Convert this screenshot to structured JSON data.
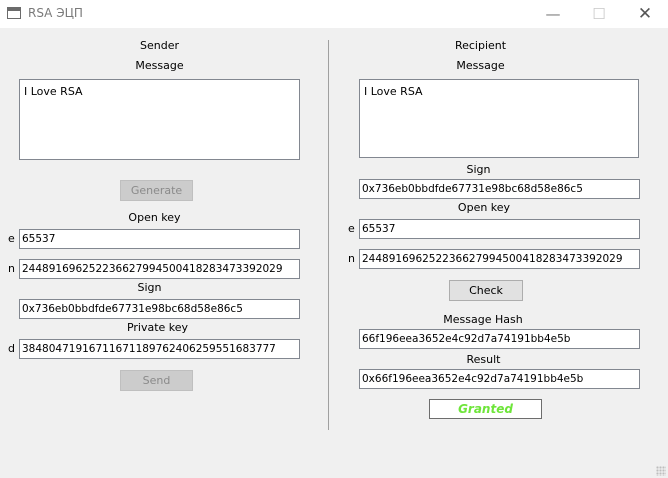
{
  "window": {
    "title": "RSA ЭЦП",
    "minimize_glyph": "—",
    "maximize_glyph": "☐",
    "close_glyph": "✕"
  },
  "sender": {
    "heading": "Sender",
    "message_label": "Message",
    "message_value": "I Love RSA",
    "generate_label": "Generate",
    "open_key_label": "Open  key",
    "e_label": "e",
    "e_value": "65537",
    "n_label": "n",
    "n_value": "244891696252236627994500418283473392029",
    "sign_label": "Sign",
    "sign_value": "0x736eb0bbdfde67731e98bc68d58e86c5",
    "private_key_label": "Private key",
    "d_label": "d",
    "d_value": "38480471916711671189762406259551683777",
    "send_label": "Send"
  },
  "recipient": {
    "heading": "Recipient",
    "message_label": "Message",
    "message_value": "I Love RSA",
    "sign_label": "Sign",
    "sign_value": "0x736eb0bbdfde67731e98bc68d58e86c5",
    "open_key_label": "Open  key",
    "e_label": "e",
    "e_value": "65537",
    "n_label": "n",
    "n_value": "244891696252236627994500418283473392029",
    "check_label": "Check",
    "hash_label": "Message Hash",
    "hash_value": "66f196eea3652e4c92d7a74191bb4e5b",
    "result_label": "Result",
    "result_value": "0x66f196eea3652e4c92d7a74191bb4e5b",
    "status": "Granted"
  }
}
